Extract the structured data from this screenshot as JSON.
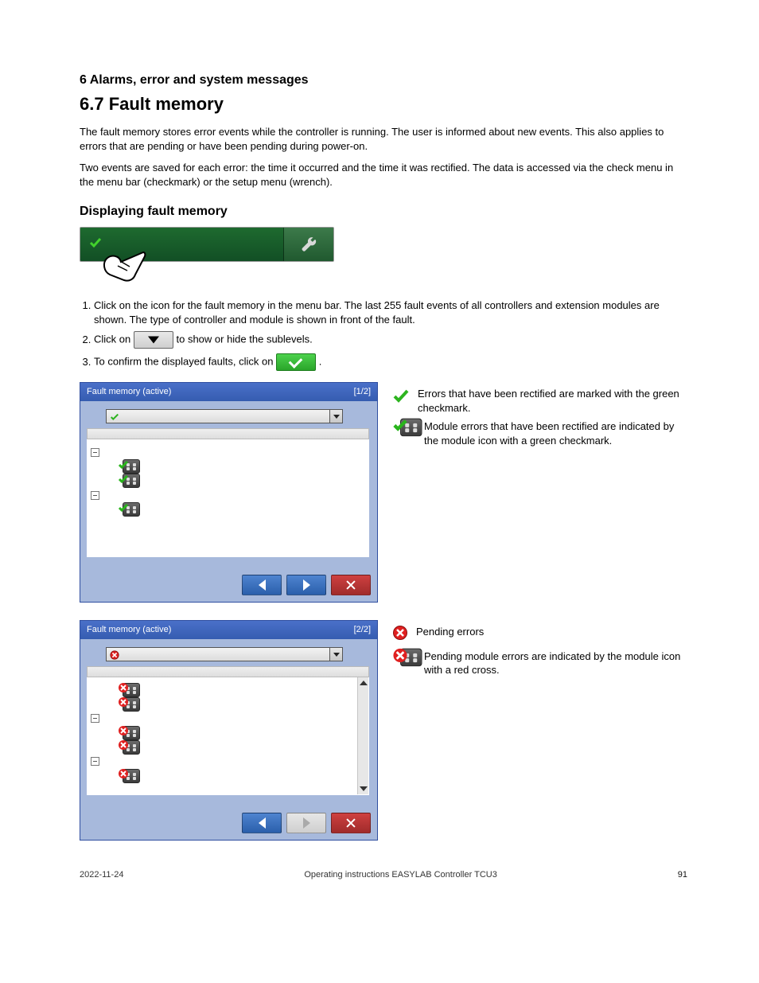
{
  "page": {
    "superheading": "6  Alarms, error and system messages",
    "heading": "6.7  Fault memory",
    "intro_1": "The fault memory stores error events while the controller is running. The user is informed about new events. This also applies to errors that are pending or have been pending during power-on.",
    "intro_2": "Two events are saved for each error: the time it occurred and the time it was rectified. The data is accessed via the check menu in the menu bar (checkmark) or the setup menu (wrench).",
    "subhead": "Displaying fault memory",
    "steps": [
      "Click on the icon for the fault memory in the menu bar. The last 255 fault events of all controllers and extension modules are shown. The type of controller and module is shown in front of the fault.",
      "Click on         to show or hide the sublevels.",
      "To confirm the displayed faults, click on          ."
    ],
    "window_1": {
      "title_left": "Fault memory (active)",
      "title_right": "[1/2]",
      "dd_label": "",
      "groups": [
        {
          "name": "",
          "items": [
            "",
            ""
          ]
        },
        {
          "name": "",
          "items": [
            ""
          ]
        }
      ]
    },
    "window_2": {
      "title_left": "Fault memory (active)",
      "title_right": "[2/2]",
      "dd_label": "",
      "groups": [
        {
          "name": "",
          "items": [
            "",
            ""
          ]
        },
        {
          "name": "",
          "items": [
            "",
            ""
          ]
        },
        {
          "name": "",
          "items": [
            ""
          ]
        }
      ]
    },
    "legend_1": [
      {
        "icon": "check",
        "text": "Errors that have been rectified are marked with the green checkmark."
      },
      {
        "icon": "module-ok",
        "text": "Module errors that have been rectified are indicated by the module icon with a green checkmark."
      }
    ],
    "legend_2": [
      {
        "icon": "error",
        "text": "Pending errors"
      },
      {
        "icon": "module-err",
        "text": "Pending module errors are indicated by the module icon with a red cross."
      }
    ]
  },
  "footer": {
    "left": "2022-11-24",
    "center": "Operating instructions EASYLAB Controller TCU3",
    "right": "91"
  }
}
